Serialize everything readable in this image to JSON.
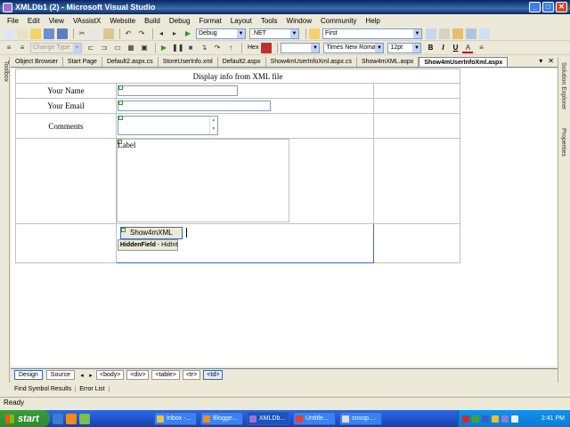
{
  "window": {
    "title": "XMLDb1 (2) - Microsoft Visual Studio"
  },
  "menu": [
    "File",
    "Edit",
    "View",
    "VAssistX",
    "Website",
    "Build",
    "Debug",
    "Format",
    "Layout",
    "Tools",
    "Window",
    "Community",
    "Help"
  ],
  "toolbar1": {
    "config": "Debug",
    "platform": ".NET",
    "find": "First"
  },
  "toolbar2": {
    "change_type": "Change Type",
    "hex": "Hex",
    "font": "Times New Roman",
    "size": "12pt",
    "bold": "B",
    "italic": "I",
    "underline": "U"
  },
  "side": {
    "toolbox": "Toolbox",
    "solution_explorer": "Solution Explorer",
    "properties": "Properties"
  },
  "doc_tabs": [
    "Object Browser",
    "Start Page",
    "Default2.aspx.cs",
    "StoreUserInfo.xml",
    "Default2.aspx",
    "Show4mUserInfoXml.aspx.cs",
    "Show4mXML.aspx",
    "Show4mUserInfoXml.aspx"
  ],
  "doc_tab_controls": {
    "dropdown": "▾",
    "close": "✕"
  },
  "form": {
    "header": "Display info from XML file",
    "name_label": "Your Name",
    "email_label": "Your Email",
    "comments_label": "Comments",
    "output_label": "Label",
    "button_label": "Show4mXML",
    "hidden_field_type": "HiddenField",
    "hidden_field_sep": " - ",
    "hidden_field_id": "HidInt"
  },
  "view": {
    "design": "Design",
    "source": "Source",
    "breadcrumb": [
      "<body>",
      "<div>",
      "<table>",
      "<tr>",
      "<td>"
    ]
  },
  "tool_windows": [
    "Find Symbol Results",
    "Error List"
  ],
  "status": "Ready",
  "taskbar": {
    "start": "start",
    "tasks": [
      "Inbox -...",
      "Blogge...",
      "XMLDb...",
      "Untitle...",
      "snoop...."
    ],
    "clock": "2:41 PM"
  },
  "colors": {
    "title": "#0a246a",
    "taskbar": "#245edb",
    "start": "#2f8a2f",
    "active_border": "#316ac5"
  }
}
